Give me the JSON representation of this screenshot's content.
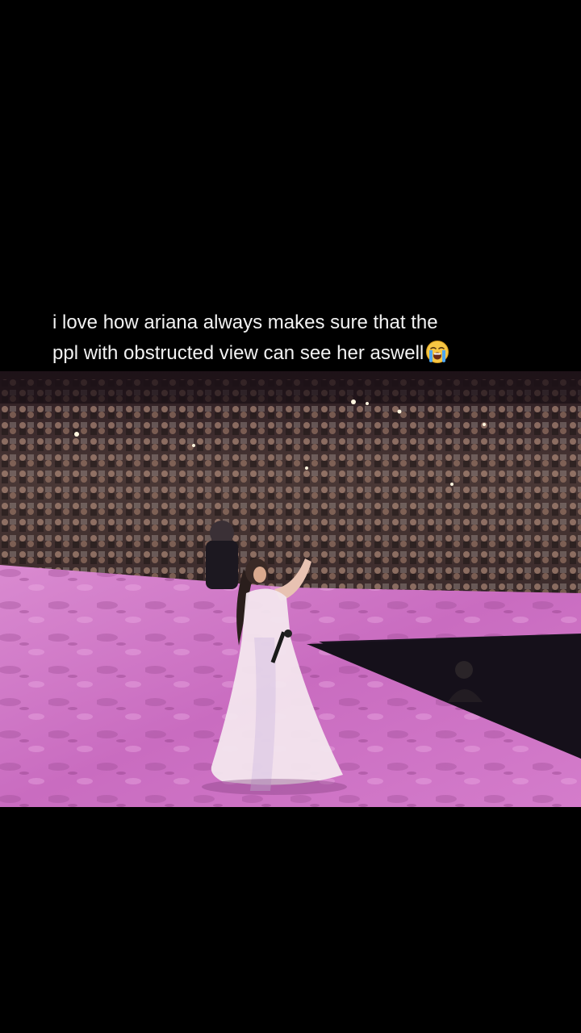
{
  "caption": {
    "line1": "i love how ariana always makes sure that the",
    "line2": "ppl with obstructed view can see her aswell",
    "emoji": "loudly-crying-face-icon"
  },
  "photo": {
    "scene": "concert",
    "colors": {
      "stage": "#d67fc8",
      "stage_shadow": "#8a3d86",
      "crowd": "#4a3836",
      "background": "#000000"
    }
  }
}
